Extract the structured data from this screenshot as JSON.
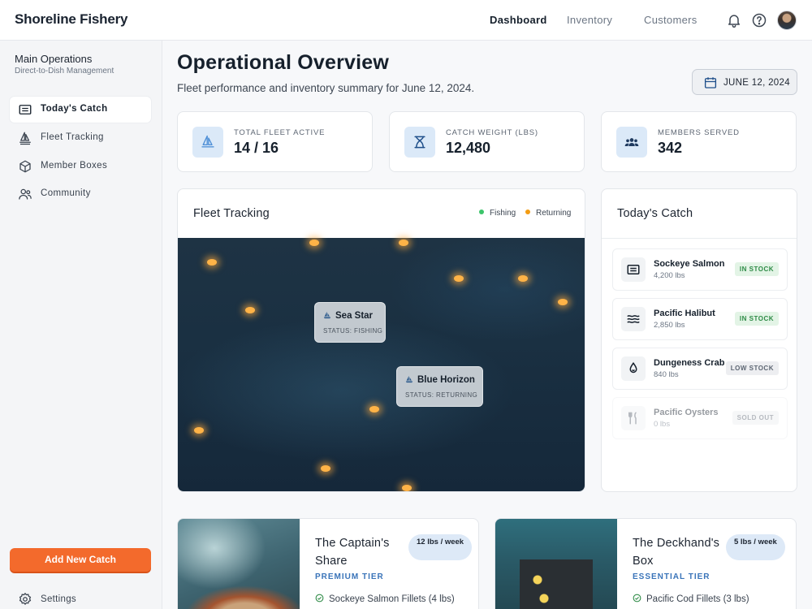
{
  "brand": "Shoreline Fishery",
  "nav": {
    "links": [
      {
        "label": "Dashboard",
        "active": true
      },
      {
        "label": "Inventory",
        "active": false
      },
      {
        "label": "Customers",
        "active": false
      }
    ],
    "icons": [
      "bell-icon",
      "help-icon",
      "avatar"
    ]
  },
  "sidebar": {
    "title": "Main Operations",
    "subtitle": "Direct-to-Dish Management",
    "items": [
      {
        "label": "Today's Catch",
        "icon": "fish-box-icon",
        "active": true
      },
      {
        "label": "Fleet Tracking",
        "icon": "sailboat-icon",
        "active": false
      },
      {
        "label": "Member Boxes",
        "icon": "box-icon",
        "active": false
      },
      {
        "label": "Community",
        "icon": "people-icon",
        "active": false
      }
    ],
    "add_button": "Add New Catch",
    "settings": "Settings"
  },
  "header": {
    "title": "Operational Overview",
    "subtitle": "Fleet performance and inventory summary for June 12, 2024.",
    "date_button": "JUNE 12, 2024"
  },
  "stats": [
    {
      "caption": "TOTAL FLEET ACTIVE",
      "value": "14 / 16",
      "icon": "sailboat-icon"
    },
    {
      "caption": "CATCH WEIGHT (LBS)",
      "value": "12,480",
      "icon": "scale-icon"
    },
    {
      "caption": "MEMBERS SERVED",
      "value": "342",
      "icon": "group-icon"
    }
  ],
  "fleet": {
    "title": "Fleet Tracking",
    "legend": [
      {
        "label": "Fishing",
        "color": "#3cc46a"
      },
      {
        "label": "Returning",
        "color": "#f39c12"
      }
    ],
    "vessels": [
      {
        "name": "Sea Star",
        "status": "STATUS: FISHING"
      },
      {
        "name": "Blue Horizon",
        "status": "STATUS: RETURNING"
      }
    ]
  },
  "catch": {
    "title": "Today's Catch",
    "items": [
      {
        "name": "Sockeye Salmon",
        "weight": "4,200 lbs",
        "status": "IN STOCK",
        "icon": "fish-icon"
      },
      {
        "name": "Pacific Halibut",
        "weight": "2,850 lbs",
        "status": "IN STOCK",
        "icon": "waves-icon"
      },
      {
        "name": "Dungeness Crab",
        "weight": "840 lbs",
        "status": "LOW STOCK",
        "icon": "crab-icon"
      },
      {
        "name": "Pacific Oysters",
        "weight": "0 lbs",
        "status": "SOLD OUT",
        "icon": "utensils-icon"
      }
    ]
  },
  "plans": [
    {
      "name": "The Captain's Share",
      "weight": "12 lbs / week",
      "tier": "PREMIUM TIER",
      "feature": "Sockeye Salmon Fillets (4 lbs)"
    },
    {
      "name": "The Deckhand's Box",
      "weight": "5 lbs / week",
      "tier": "ESSENTIAL TIER",
      "feature": "Pacific Cod Fillets (3 lbs)"
    }
  ],
  "colors": {
    "accent": "#f36a2c",
    "tier": "#3a74b9",
    "in_stock": "#2e8b46"
  }
}
